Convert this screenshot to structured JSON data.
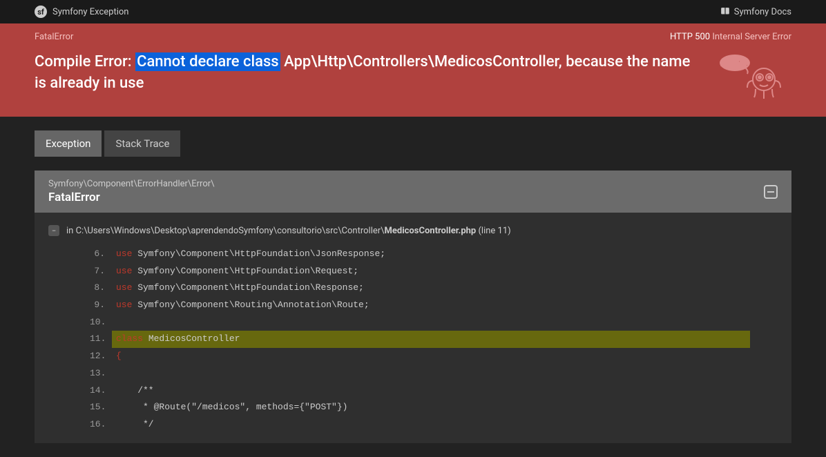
{
  "header": {
    "app_label": "Symfony Exception",
    "docs_label": "Symfony Docs"
  },
  "banner": {
    "error_type": "FatalError",
    "http_status": "HTTP 500",
    "http_text": "Internal Server Error",
    "msg_prefix": "Compile Error: ",
    "msg_highlight": "Cannot declare class",
    "msg_suffix": "App\\Http\\Controllers\\MedicosController, because the name is already in use"
  },
  "tabs": {
    "exception": "Exception",
    "stack": "Stack Trace"
  },
  "panel": {
    "namespace": "Symfony\\Component\\ErrorHandler\\Error\\",
    "classname": "FatalError",
    "loc_prefix": "in ",
    "loc_path": "C:\\Users\\Windows\\Desktop\\aprendendoSymfony\\consultorio\\src\\Controller\\",
    "loc_file": "MedicosController.php",
    "loc_line": " (line 11)"
  },
  "code": [
    {
      "n": "6.",
      "kw": "use",
      "rest": " Symfony\\Component\\HttpFoundation\\JsonResponse;",
      "hl": false
    },
    {
      "n": "7.",
      "kw": "use",
      "rest": " Symfony\\Component\\HttpFoundation\\Request;",
      "hl": false
    },
    {
      "n": "8.",
      "kw": "use",
      "rest": " Symfony\\Component\\HttpFoundation\\Response;",
      "hl": false
    },
    {
      "n": "9.",
      "kw": "use",
      "rest": " Symfony\\Component\\Routing\\Annotation\\Route;",
      "hl": false
    },
    {
      "n": "10.",
      "kw": "",
      "rest": "",
      "hl": false
    },
    {
      "n": "11.",
      "kw": "class",
      "rest": " MedicosController",
      "hl": true
    },
    {
      "n": "12.",
      "kw": "{",
      "rest": "",
      "hl": false
    },
    {
      "n": "13.",
      "kw": "",
      "rest": "",
      "hl": false
    },
    {
      "n": "14.",
      "kw": "",
      "rest": "    /**",
      "hl": false
    },
    {
      "n": "15.",
      "kw": "",
      "rest": "     * @Route(\"/medicos\", methods={\"POST\"})",
      "hl": false
    },
    {
      "n": "16.",
      "kw": "",
      "rest": "     */",
      "hl": false
    }
  ]
}
